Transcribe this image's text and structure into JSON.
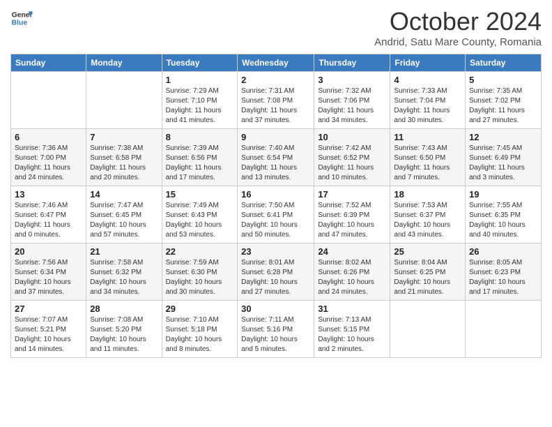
{
  "logo": {
    "text_general": "General",
    "text_blue": "Blue"
  },
  "header": {
    "month_title": "October 2024",
    "subtitle": "Andrid, Satu Mare County, Romania"
  },
  "days_of_week": [
    "Sunday",
    "Monday",
    "Tuesday",
    "Wednesday",
    "Thursday",
    "Friday",
    "Saturday"
  ],
  "weeks": [
    [
      {
        "day": "",
        "sunrise": "",
        "sunset": "",
        "daylight": ""
      },
      {
        "day": "",
        "sunrise": "",
        "sunset": "",
        "daylight": ""
      },
      {
        "day": "1",
        "sunrise": "Sunrise: 7:29 AM",
        "sunset": "Sunset: 7:10 PM",
        "daylight": "Daylight: 11 hours and 41 minutes."
      },
      {
        "day": "2",
        "sunrise": "Sunrise: 7:31 AM",
        "sunset": "Sunset: 7:08 PM",
        "daylight": "Daylight: 11 hours and 37 minutes."
      },
      {
        "day": "3",
        "sunrise": "Sunrise: 7:32 AM",
        "sunset": "Sunset: 7:06 PM",
        "daylight": "Daylight: 11 hours and 34 minutes."
      },
      {
        "day": "4",
        "sunrise": "Sunrise: 7:33 AM",
        "sunset": "Sunset: 7:04 PM",
        "daylight": "Daylight: 11 hours and 30 minutes."
      },
      {
        "day": "5",
        "sunrise": "Sunrise: 7:35 AM",
        "sunset": "Sunset: 7:02 PM",
        "daylight": "Daylight: 11 hours and 27 minutes."
      }
    ],
    [
      {
        "day": "6",
        "sunrise": "Sunrise: 7:36 AM",
        "sunset": "Sunset: 7:00 PM",
        "daylight": "Daylight: 11 hours and 24 minutes."
      },
      {
        "day": "7",
        "sunrise": "Sunrise: 7:38 AM",
        "sunset": "Sunset: 6:58 PM",
        "daylight": "Daylight: 11 hours and 20 minutes."
      },
      {
        "day": "8",
        "sunrise": "Sunrise: 7:39 AM",
        "sunset": "Sunset: 6:56 PM",
        "daylight": "Daylight: 11 hours and 17 minutes."
      },
      {
        "day": "9",
        "sunrise": "Sunrise: 7:40 AM",
        "sunset": "Sunset: 6:54 PM",
        "daylight": "Daylight: 11 hours and 13 minutes."
      },
      {
        "day": "10",
        "sunrise": "Sunrise: 7:42 AM",
        "sunset": "Sunset: 6:52 PM",
        "daylight": "Daylight: 11 hours and 10 minutes."
      },
      {
        "day": "11",
        "sunrise": "Sunrise: 7:43 AM",
        "sunset": "Sunset: 6:50 PM",
        "daylight": "Daylight: 11 hours and 7 minutes."
      },
      {
        "day": "12",
        "sunrise": "Sunrise: 7:45 AM",
        "sunset": "Sunset: 6:49 PM",
        "daylight": "Daylight: 11 hours and 3 minutes."
      }
    ],
    [
      {
        "day": "13",
        "sunrise": "Sunrise: 7:46 AM",
        "sunset": "Sunset: 6:47 PM",
        "daylight": "Daylight: 11 hours and 0 minutes."
      },
      {
        "day": "14",
        "sunrise": "Sunrise: 7:47 AM",
        "sunset": "Sunset: 6:45 PM",
        "daylight": "Daylight: 10 hours and 57 minutes."
      },
      {
        "day": "15",
        "sunrise": "Sunrise: 7:49 AM",
        "sunset": "Sunset: 6:43 PM",
        "daylight": "Daylight: 10 hours and 53 minutes."
      },
      {
        "day": "16",
        "sunrise": "Sunrise: 7:50 AM",
        "sunset": "Sunset: 6:41 PM",
        "daylight": "Daylight: 10 hours and 50 minutes."
      },
      {
        "day": "17",
        "sunrise": "Sunrise: 7:52 AM",
        "sunset": "Sunset: 6:39 PM",
        "daylight": "Daylight: 10 hours and 47 minutes."
      },
      {
        "day": "18",
        "sunrise": "Sunrise: 7:53 AM",
        "sunset": "Sunset: 6:37 PM",
        "daylight": "Daylight: 10 hours and 43 minutes."
      },
      {
        "day": "19",
        "sunrise": "Sunrise: 7:55 AM",
        "sunset": "Sunset: 6:35 PM",
        "daylight": "Daylight: 10 hours and 40 minutes."
      }
    ],
    [
      {
        "day": "20",
        "sunrise": "Sunrise: 7:56 AM",
        "sunset": "Sunset: 6:34 PM",
        "daylight": "Daylight: 10 hours and 37 minutes."
      },
      {
        "day": "21",
        "sunrise": "Sunrise: 7:58 AM",
        "sunset": "Sunset: 6:32 PM",
        "daylight": "Daylight: 10 hours and 34 minutes."
      },
      {
        "day": "22",
        "sunrise": "Sunrise: 7:59 AM",
        "sunset": "Sunset: 6:30 PM",
        "daylight": "Daylight: 10 hours and 30 minutes."
      },
      {
        "day": "23",
        "sunrise": "Sunrise: 8:01 AM",
        "sunset": "Sunset: 6:28 PM",
        "daylight": "Daylight: 10 hours and 27 minutes."
      },
      {
        "day": "24",
        "sunrise": "Sunrise: 8:02 AM",
        "sunset": "Sunset: 6:26 PM",
        "daylight": "Daylight: 10 hours and 24 minutes."
      },
      {
        "day": "25",
        "sunrise": "Sunrise: 8:04 AM",
        "sunset": "Sunset: 6:25 PM",
        "daylight": "Daylight: 10 hours and 21 minutes."
      },
      {
        "day": "26",
        "sunrise": "Sunrise: 8:05 AM",
        "sunset": "Sunset: 6:23 PM",
        "daylight": "Daylight: 10 hours and 17 minutes."
      }
    ],
    [
      {
        "day": "27",
        "sunrise": "Sunrise: 7:07 AM",
        "sunset": "Sunset: 5:21 PM",
        "daylight": "Daylight: 10 hours and 14 minutes."
      },
      {
        "day": "28",
        "sunrise": "Sunrise: 7:08 AM",
        "sunset": "Sunset: 5:20 PM",
        "daylight": "Daylight: 10 hours and 11 minutes."
      },
      {
        "day": "29",
        "sunrise": "Sunrise: 7:10 AM",
        "sunset": "Sunset: 5:18 PM",
        "daylight": "Daylight: 10 hours and 8 minutes."
      },
      {
        "day": "30",
        "sunrise": "Sunrise: 7:11 AM",
        "sunset": "Sunset: 5:16 PM",
        "daylight": "Daylight: 10 hours and 5 minutes."
      },
      {
        "day": "31",
        "sunrise": "Sunrise: 7:13 AM",
        "sunset": "Sunset: 5:15 PM",
        "daylight": "Daylight: 10 hours and 2 minutes."
      },
      {
        "day": "",
        "sunrise": "",
        "sunset": "",
        "daylight": ""
      },
      {
        "day": "",
        "sunrise": "",
        "sunset": "",
        "daylight": ""
      }
    ]
  ]
}
